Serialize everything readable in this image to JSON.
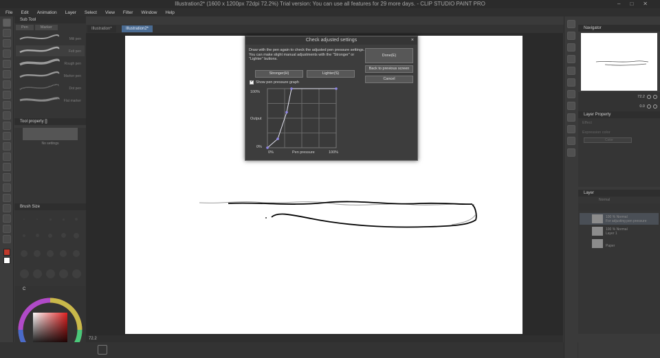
{
  "window": {
    "title": "Illustration2* (1600 x 1200px 72dpi 72.2%)  Trial version: You can use all features for 29 more days. - CLIP STUDIO PAINT PRO"
  },
  "menu": [
    "File",
    "Edit",
    "Animation",
    "Layer",
    "Select",
    "View",
    "Filter",
    "Window",
    "Help"
  ],
  "tabs": [
    {
      "label": "Illustration*",
      "active": false
    },
    {
      "label": "Illustration2*",
      "active": true
    }
  ],
  "left": {
    "subtool": {
      "title": "Sub Tool",
      "tabs": [
        "Pen",
        "Marker"
      ],
      "items": [
        "Mili pen",
        "Felt pen",
        "Rough pen",
        "Marker pen",
        "Dot pen",
        "Flat marker"
      ]
    },
    "toolprop": {
      "title": "Tool property []",
      "empty": "No settings"
    },
    "brushsize": {
      "title": "Brush Size"
    },
    "colorpanel": {
      "mode": "C"
    }
  },
  "dialog": {
    "title": "Check adjusted settings",
    "close": "×",
    "description": "Draw with the pen again to check the adjusted pen pressure settings. You can make slight manual adjustments with the \"Stronger\" or \"Lighter\" buttons.",
    "done": "Done(E)",
    "back": "Back to previous screen",
    "cancel": "Cancel",
    "stronger": "Stronger(H)",
    "lighter": "Lighter(S)",
    "show_graph": "Show pen pressure graph",
    "graph": {
      "y_top": "100%",
      "y_mid": "Output",
      "y_bottom": "0%",
      "x_left": "0%",
      "x_mid": "Pen pressure",
      "x_right": "100%",
      "points": [
        [
          0,
          0
        ],
        [
          0.15,
          0.15
        ],
        [
          0.28,
          0.6
        ],
        [
          0.35,
          1.0
        ],
        [
          1.0,
          1.0
        ]
      ]
    }
  },
  "status": {
    "zoom": "72.2"
  },
  "right": {
    "navigator": {
      "title": "Navigator",
      "zoom": "72.2",
      "rotation": "0.0"
    },
    "layerprop": {
      "title": "Layer Property",
      "effect": "Effect",
      "expression": "Expression color",
      "color": "Color"
    },
    "layer": {
      "title": "Layer",
      "blend": "Normal",
      "rows": [
        {
          "name": "100 % Normal",
          "sub": "For adjusting pen pressure",
          "selected": true
        },
        {
          "name": "100 % Normal",
          "sub": "Layer 1",
          "selected": false
        },
        {
          "name": "",
          "sub": "Paper",
          "selected": false
        }
      ]
    }
  }
}
